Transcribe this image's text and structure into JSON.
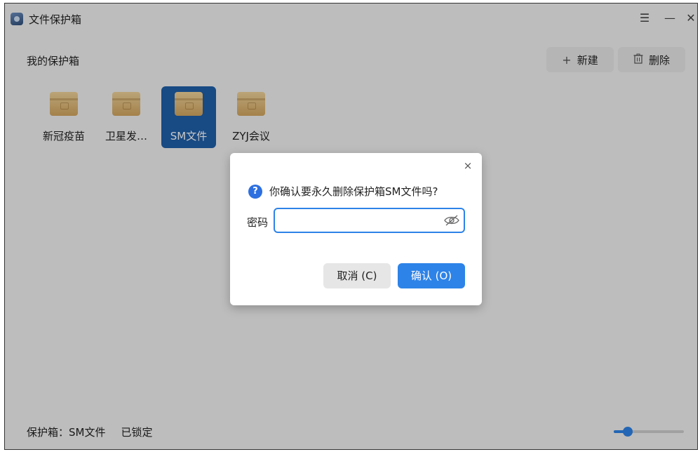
{
  "window": {
    "title": "文件保护箱",
    "controls": {
      "menu": "☰",
      "minimize": "—",
      "close": "✕"
    }
  },
  "header": {
    "title": "我的保护箱",
    "new_icon": "+",
    "new_label": "新建",
    "delete_icon": "trash-icon",
    "delete_label": "删除"
  },
  "vaults": [
    {
      "label": "新冠疫苗",
      "selected": false
    },
    {
      "label": "卫星发…",
      "selected": false
    },
    {
      "label": "SM文件",
      "selected": true
    },
    {
      "label": "ZYJ会议",
      "selected": false
    }
  ],
  "status": {
    "vault": "保护箱：SM文件",
    "state": "已锁定"
  },
  "zoom_slider": {
    "value_fraction": 0.2
  },
  "dialog": {
    "close": "×",
    "icon": "?",
    "message": "你确认要永久删除保护箱SM文件吗?",
    "password_label": "密码",
    "password_value": "",
    "cancel_label": "取消 (C)",
    "confirm_label": "确认 (O)"
  },
  "colors": {
    "accent": "#2d83e8",
    "selected_tile": "#1f5fa8"
  }
}
